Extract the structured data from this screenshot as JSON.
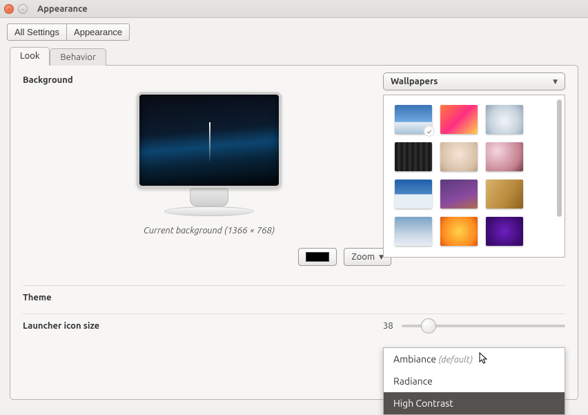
{
  "window": {
    "title": "Appearance"
  },
  "toolbar": {
    "all_settings": "All Settings",
    "appearance": "Appearance"
  },
  "tabs": {
    "look": "Look",
    "behavior": "Behavior"
  },
  "background": {
    "label": "Background",
    "caption": "Current background (1366 × 768)",
    "zoom_label": "Zoom",
    "dropdown_label": "Wallpapers"
  },
  "theme": {
    "label": "Theme",
    "options": {
      "ambiance": "Ambiance",
      "default_suffix": "(default)",
      "radiance": "Radiance",
      "high_contrast": "High Contrast"
    }
  },
  "launcher": {
    "label": "Launcher icon size",
    "value": "38"
  },
  "thumbs": [
    {
      "bg": "linear-gradient(#3a73b6 0%,#6ea8de 58%,#e8eef5 60%,#a9c3da 100%)",
      "selected": true
    },
    {
      "bg": "linear-gradient(135deg,#ff7a3c,#ff2e83,#ffd24a)"
    },
    {
      "bg": "radial-gradient(circle at 50% 55%,#f2f5f8,#c6d2dd 60%,#8ea2b3)"
    },
    {
      "bg": "repeating-linear-gradient(90deg,#1a1a1a 0 4px,#2c2c2c 4px 8px)"
    },
    {
      "bg": "radial-gradient(circle at 50% 40%,#f7e4d6,#d8c1a8 70%,#bba07f)"
    },
    {
      "bg": "radial-gradient(circle at 30% 30%,#f5d7df,#c47f8f 70%,#6b3d43)"
    },
    {
      "bg": "linear-gradient(#1f5fa9,#4a86c5 50%,#e8eef5 52%,#e8eef5)"
    },
    {
      "bg": "linear-gradient(160deg,#5a3a7a,#8a4aa0 60%,#b06a50)"
    },
    {
      "bg": "linear-gradient(120deg,#d8b26a,#b88a3c 60%,#8c5f1f)"
    },
    {
      "bg": "linear-gradient(#7aa3c7,#c6d6e3 60%,#e8eef5)"
    },
    {
      "bg": "radial-gradient(circle at 50% 50%,#ffd24a,#ff8a1f 70%,#d94e0e)"
    },
    {
      "bg": "radial-gradient(circle at 50% 50%,#6b1fbf,#3a0a6b 80%)"
    }
  ]
}
